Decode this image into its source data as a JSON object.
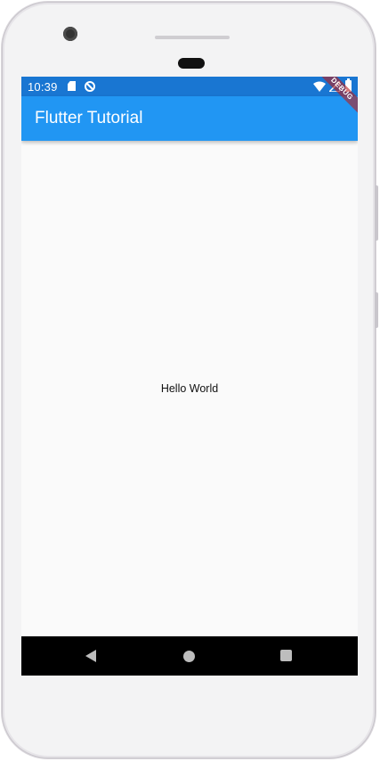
{
  "status_bar": {
    "time": "10:39",
    "debug_label": "DEBUG",
    "color": "#1976d2"
  },
  "app_bar": {
    "title": "Flutter Tutorial",
    "color": "#2196f3"
  },
  "body": {
    "text": "Hello World"
  },
  "icons": {
    "status": [
      "sd-card-icon",
      "sync-icon",
      "wifi-icon",
      "signal-icon",
      "battery-icon"
    ],
    "navigation": [
      "back-icon",
      "home-icon",
      "recents-icon"
    ]
  }
}
